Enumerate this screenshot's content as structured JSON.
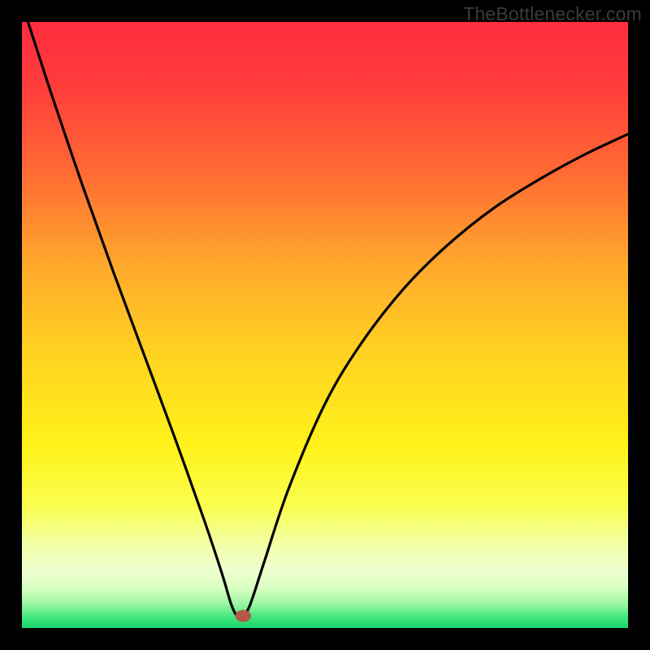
{
  "watermark": "TheBottlenecker.com",
  "chart_data": {
    "type": "line",
    "title": "",
    "xlabel": "",
    "ylabel": "",
    "xlim": [
      0,
      1
    ],
    "ylim": [
      0,
      1
    ],
    "grid": false,
    "background_gradient": {
      "stops": [
        {
          "offset": 0.0,
          "color": "#ff2d3e"
        },
        {
          "offset": 0.1,
          "color": "#ff3b3b"
        },
        {
          "offset": 0.25,
          "color": "#ff6b34"
        },
        {
          "offset": 0.4,
          "color": "#ffa82c"
        },
        {
          "offset": 0.55,
          "color": "#ffd320"
        },
        {
          "offset": 0.7,
          "color": "#fff21a"
        },
        {
          "offset": 0.8,
          "color": "#faff4f"
        },
        {
          "offset": 0.86,
          "color": "#f2ffa5"
        },
        {
          "offset": 0.905,
          "color": "#eeffd0"
        },
        {
          "offset": 0.935,
          "color": "#d7ffc1"
        },
        {
          "offset": 0.96,
          "color": "#9cf7a2"
        },
        {
          "offset": 0.985,
          "color": "#38e37a"
        },
        {
          "offset": 1.0,
          "color": "#18d46a"
        }
      ]
    },
    "curve": {
      "x0": 0.355,
      "points": [
        {
          "x": 0.01,
          "y": 1.0
        },
        {
          "x": 0.05,
          "y": 0.877
        },
        {
          "x": 0.1,
          "y": 0.73
        },
        {
          "x": 0.15,
          "y": 0.59
        },
        {
          "x": 0.2,
          "y": 0.455
        },
        {
          "x": 0.25,
          "y": 0.32
        },
        {
          "x": 0.3,
          "y": 0.18
        },
        {
          "x": 0.33,
          "y": 0.09
        },
        {
          "x": 0.345,
          "y": 0.04
        },
        {
          "x": 0.355,
          "y": 0.02
        },
        {
          "x": 0.365,
          "y": 0.02
        },
        {
          "x": 0.377,
          "y": 0.04
        },
        {
          "x": 0.4,
          "y": 0.11
        },
        {
          "x": 0.44,
          "y": 0.23
        },
        {
          "x": 0.5,
          "y": 0.37
        },
        {
          "x": 0.56,
          "y": 0.47
        },
        {
          "x": 0.63,
          "y": 0.56
        },
        {
          "x": 0.7,
          "y": 0.63
        },
        {
          "x": 0.78,
          "y": 0.694
        },
        {
          "x": 0.86,
          "y": 0.744
        },
        {
          "x": 0.93,
          "y": 0.782
        },
        {
          "x": 1.0,
          "y": 0.815
        }
      ]
    },
    "marker": {
      "x": 0.365,
      "y": 0.02,
      "color": "#b35a4a",
      "rx": 0.013,
      "ry": 0.01
    }
  }
}
